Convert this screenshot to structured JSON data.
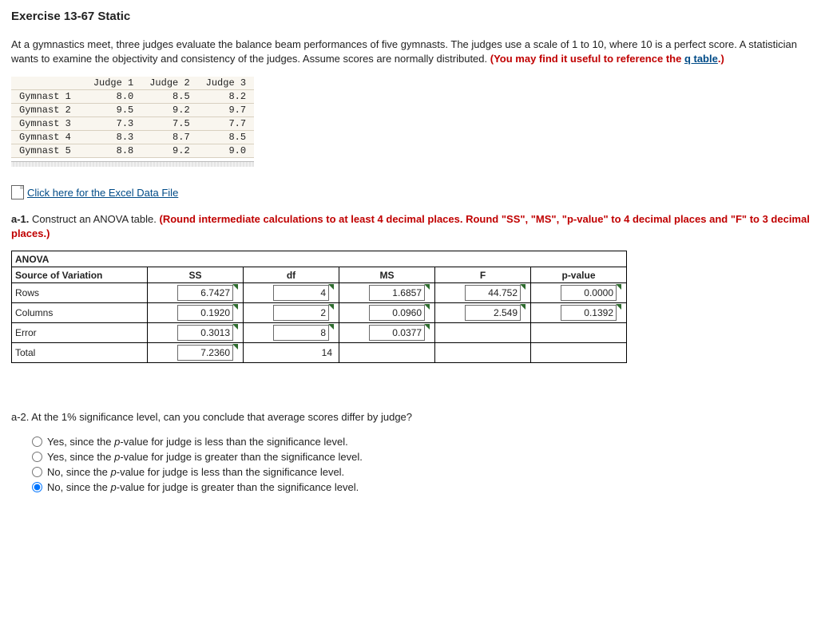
{
  "title": "Exercise 13-67 Static",
  "intro_1": "At a gymnastics meet, three judges evaluate the balance beam performances of five gymnasts. The judges use a scale of 1 to 10, where 10 is a perfect score. A statistician wants to examine the objectivity and consistency of the judges. Assume scores are normally distributed. ",
  "intro_red_prefix": "(You may find it useful to reference the ",
  "intro_link": "q table",
  "intro_red_suffix": ".)",
  "scores": {
    "headers": [
      "",
      "Judge 1",
      "Judge 2",
      "Judge 3"
    ],
    "rows": [
      {
        "label": "Gymnast 1",
        "v": [
          "8.0",
          "8.5",
          "8.2"
        ]
      },
      {
        "label": "Gymnast 2",
        "v": [
          "9.5",
          "9.2",
          "9.7"
        ]
      },
      {
        "label": "Gymnast 3",
        "v": [
          "7.3",
          "7.5",
          "7.7"
        ]
      },
      {
        "label": "Gymnast 4",
        "v": [
          "8.3",
          "8.7",
          "8.5"
        ]
      },
      {
        "label": "Gymnast 5",
        "v": [
          "8.8",
          "9.2",
          "9.0"
        ]
      }
    ]
  },
  "excel_link": " Click here for the Excel Data File",
  "a1_label_bold": "a-1.",
  "a1_text": " Construct an ANOVA table. ",
  "a1_red": "(Round intermediate calculations to at least 4 decimal places. Round \"SS\", \"MS\", \"p-value\" to 4 decimal places and \"F\" to 3 decimal places.)",
  "anova": {
    "title": "ANOVA",
    "cols": [
      "Source of Variation",
      "SS",
      "df",
      "MS",
      "F",
      "p-value"
    ],
    "rows": [
      {
        "src": "Rows",
        "ss": "6.7427",
        "df": "4",
        "ms": "1.6857",
        "f": "44.752",
        "p": "0.0000"
      },
      {
        "src": "Columns",
        "ss": "0.1920",
        "df": "2",
        "ms": "0.0960",
        "f": "2.549",
        "p": "0.1392"
      },
      {
        "src": "Error",
        "ss": "0.3013",
        "df": "8",
        "ms": "0.0377",
        "f": "",
        "p": ""
      },
      {
        "src": "Total",
        "ss": "7.2360",
        "df": "14",
        "ms": "",
        "f": "",
        "p": ""
      }
    ],
    "flags": {
      "rows_cols_flagged": [
        "ss",
        "df",
        "ms",
        "f",
        "p"
      ]
    }
  },
  "a2_label_bold": "a-2.",
  "a2_text": " At the 1% significance level, can you conclude that average scores differ by judge?",
  "options": [
    "Yes, since the p-value for judge is less than the significance level.",
    "Yes, since the p-value for judge is greater than the significance level.",
    "No, since the p-value for judge is less than the significance level.",
    "No, since the p-value for judge is greater than the significance level."
  ],
  "selected_index": 3
}
